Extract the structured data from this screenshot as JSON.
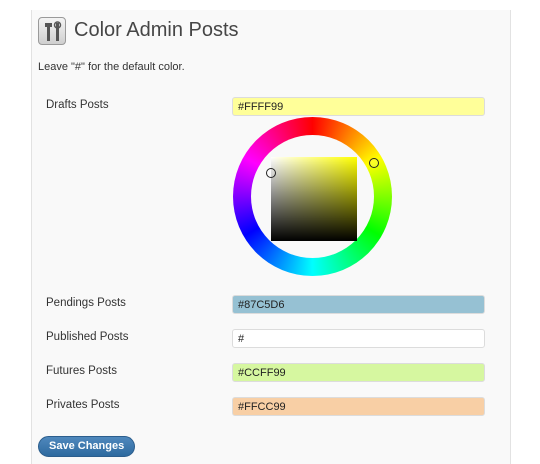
{
  "header": {
    "title": "Color Admin Posts",
    "icon": "tools-icon"
  },
  "note": "Leave \"#\" for the default color.",
  "fields": [
    {
      "label": "Drafts Posts",
      "value": "#FFFF99",
      "color": "#FFFF99"
    },
    {
      "label": "Pendings Posts",
      "value": "#87C5D6",
      "color": "#96C1D3"
    },
    {
      "label": "Published Posts",
      "value": "#",
      "color": "#FFFFFF"
    },
    {
      "label": "Futures Posts",
      "value": "#CCFF99",
      "color": "#D6F7A0"
    },
    {
      "label": "Privates Posts",
      "value": "#FFCC99",
      "color": "#F8CFA5"
    }
  ],
  "save_label": "Save Changes"
}
